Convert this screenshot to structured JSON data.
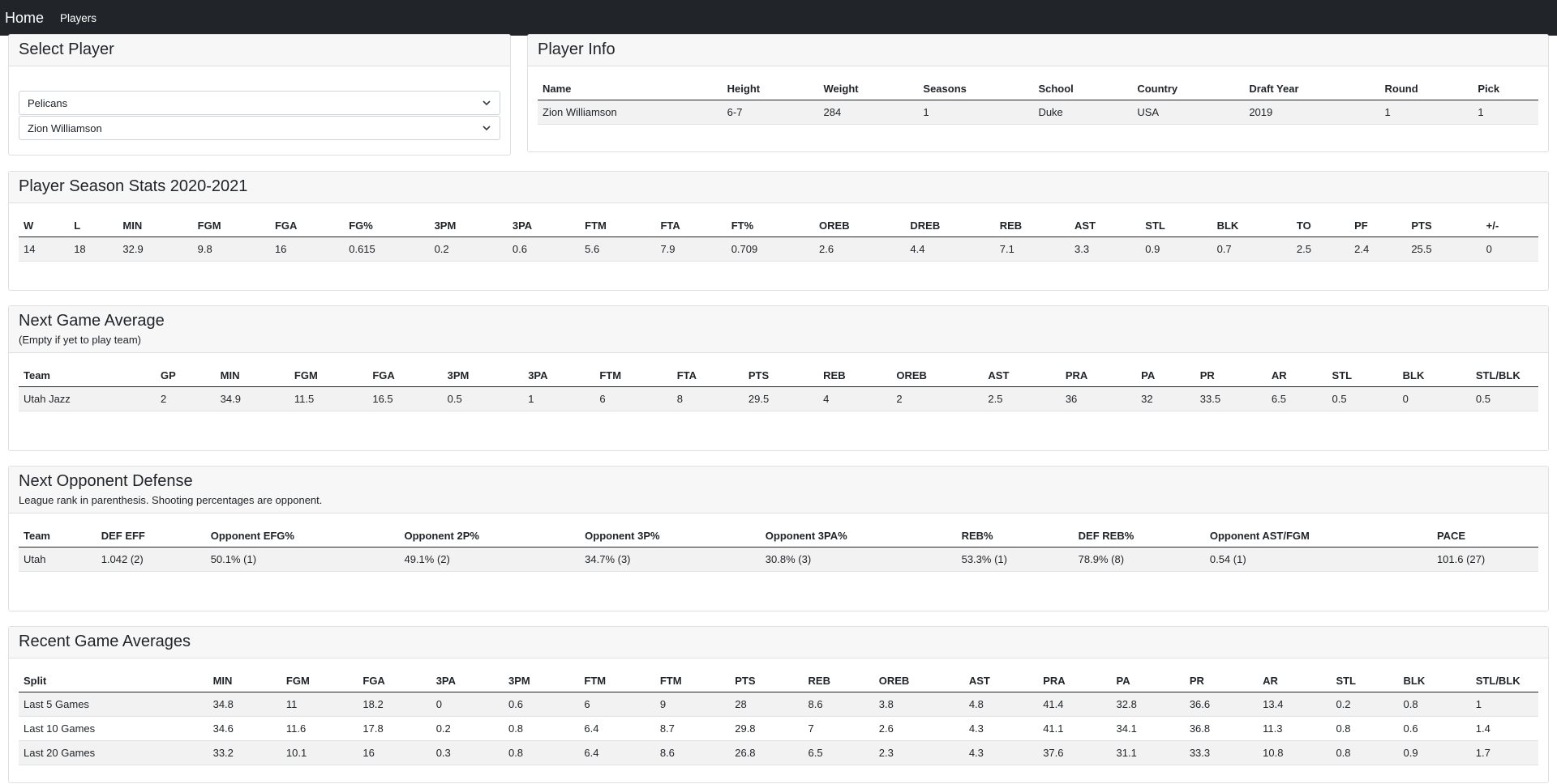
{
  "nav": {
    "brand": "Home",
    "players": "Players"
  },
  "select_player": {
    "title": "Select Player",
    "team_value": "Pelicans",
    "player_value": "Zion Williamson"
  },
  "player_info": {
    "title": "Player Info",
    "headers": [
      "Name",
      "Height",
      "Weight",
      "Seasons",
      "School",
      "Country",
      "Draft Year",
      "Round",
      "Pick"
    ],
    "rows": [
      [
        "Zion Williamson",
        "6-7",
        "284",
        "1",
        "Duke",
        "USA",
        "2019",
        "1",
        "1"
      ]
    ]
  },
  "season_stats": {
    "title": "Player Season Stats 2020-2021",
    "headers": [
      "W",
      "L",
      "MIN",
      "FGM",
      "FGA",
      "FG%",
      "3PM",
      "3PA",
      "FTM",
      "FTA",
      "FT%",
      "OREB",
      "DREB",
      "REB",
      "AST",
      "STL",
      "BLK",
      "TO",
      "PF",
      "PTS",
      "+/-"
    ],
    "rows": [
      [
        "14",
        "18",
        "32.9",
        "9.8",
        "16",
        "0.615",
        "0.2",
        "0.6",
        "5.6",
        "7.9",
        "0.709",
        "2.6",
        "4.4",
        "7.1",
        "3.3",
        "0.9",
        "0.7",
        "2.5",
        "2.4",
        "25.5",
        "0"
      ]
    ]
  },
  "next_game": {
    "title": "Next Game Average",
    "subtitle": "(Empty if yet to play team)",
    "headers": [
      "Team",
      "GP",
      "MIN",
      "FGM",
      "FGA",
      "3PM",
      "3PA",
      "FTM",
      "FTA",
      "PTS",
      "REB",
      "OREB",
      "AST",
      "PRA",
      "PA",
      "PR",
      "AR",
      "STL",
      "BLK",
      "STL/BLK"
    ],
    "rows": [
      [
        "Utah Jazz",
        "2",
        "34.9",
        "11.5",
        "16.5",
        "0.5",
        "1",
        "6",
        "8",
        "29.5",
        "4",
        "2",
        "2.5",
        "36",
        "32",
        "33.5",
        "6.5",
        "0.5",
        "0",
        "0.5"
      ]
    ]
  },
  "opp_defense": {
    "title": "Next Opponent Defense",
    "subtitle": "League rank in parenthesis. Shooting percentages are opponent.",
    "headers": [
      "Team",
      "DEF EFF",
      "Opponent EFG%",
      "Opponent 2P%",
      "Opponent 3P%",
      "Opponent 3PA%",
      "REB%",
      "DEF REB%",
      "Opponent AST/FGM",
      "PACE"
    ],
    "rows": [
      [
        "Utah",
        "1.042 (2)",
        "50.1% (1)",
        "49.1% (2)",
        "34.7% (3)",
        "30.8% (3)",
        "53.3% (1)",
        "78.9% (8)",
        "0.54 (1)",
        "101.6 (27)"
      ]
    ]
  },
  "recent": {
    "title": "Recent Game Averages",
    "headers": [
      "Split",
      "MIN",
      "FGM",
      "FGA",
      "3PA",
      "3PM",
      "FTM",
      "FTM",
      "PTS",
      "REB",
      "OREB",
      "AST",
      "PRA",
      "PA",
      "PR",
      "AR",
      "STL",
      "BLK",
      "STL/BLK"
    ],
    "rows": [
      [
        "Last 5 Games",
        "34.8",
        "11",
        "18.2",
        "0",
        "0.6",
        "6",
        "9",
        "28",
        "8.6",
        "3.8",
        "4.8",
        "41.4",
        "32.8",
        "36.6",
        "13.4",
        "0.2",
        "0.8",
        "1"
      ],
      [
        "Last 10 Games",
        "34.6",
        "11.6",
        "17.8",
        "0.2",
        "0.8",
        "6.4",
        "8.7",
        "29.8",
        "7",
        "2.6",
        "4.3",
        "41.1",
        "34.1",
        "36.8",
        "11.3",
        "0.8",
        "0.6",
        "1.4"
      ],
      [
        "Last 20 Games",
        "33.2",
        "10.1",
        "16",
        "0.3",
        "0.8",
        "6.4",
        "8.6",
        "26.8",
        "6.5",
        "2.3",
        "4.3",
        "37.6",
        "31.1",
        "33.3",
        "10.8",
        "0.8",
        "0.9",
        "1.7"
      ]
    ]
  }
}
